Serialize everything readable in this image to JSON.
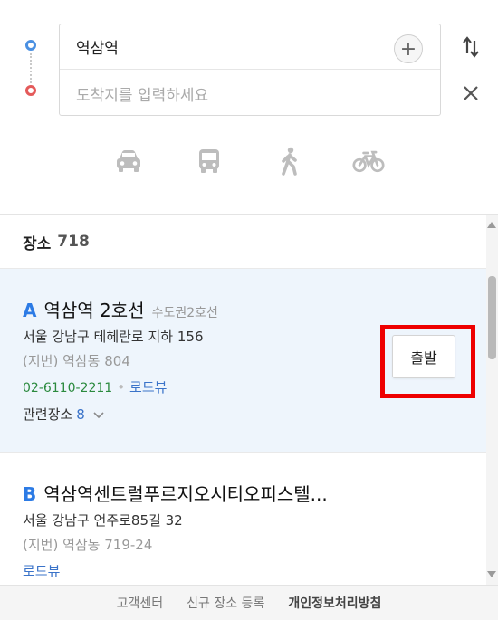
{
  "route": {
    "origin_value": "역삼역",
    "destination_placeholder": "도착지를 입력하세요",
    "add_label": "+",
    "modes": [
      "car",
      "bus",
      "walk",
      "bicycle"
    ]
  },
  "results": {
    "label": "장소",
    "count": "718",
    "items": [
      {
        "letter": "A",
        "name": "역삼역 2호선",
        "category": "수도권2호선",
        "address": "서울 강남구 테헤란로 지하 156",
        "jibun": "(지번) 역삼동 804",
        "phone": "02-6110-2211",
        "roadview": "로드뷰",
        "related_label": "관련장소",
        "related_count": "8",
        "depart_label": "출발"
      },
      {
        "letter": "B",
        "name": "역삼역센트럴푸르지오시티오피스텔...",
        "address": "서울 강남구 언주로85길 32",
        "jibun": "(지번) 역삼동 719-24",
        "roadview": "로드뷰"
      }
    ]
  },
  "footer": {
    "customer_center": "고객센터",
    "new_place": "신규 장소 등록",
    "privacy": "개인정보처리방침"
  },
  "colors": {
    "start_dot": "#4a90e2",
    "end_dot": "#e45a5a",
    "highlight": "#ee0000",
    "selected_bg": "#eef5fc",
    "letter": "#2c7be5"
  }
}
